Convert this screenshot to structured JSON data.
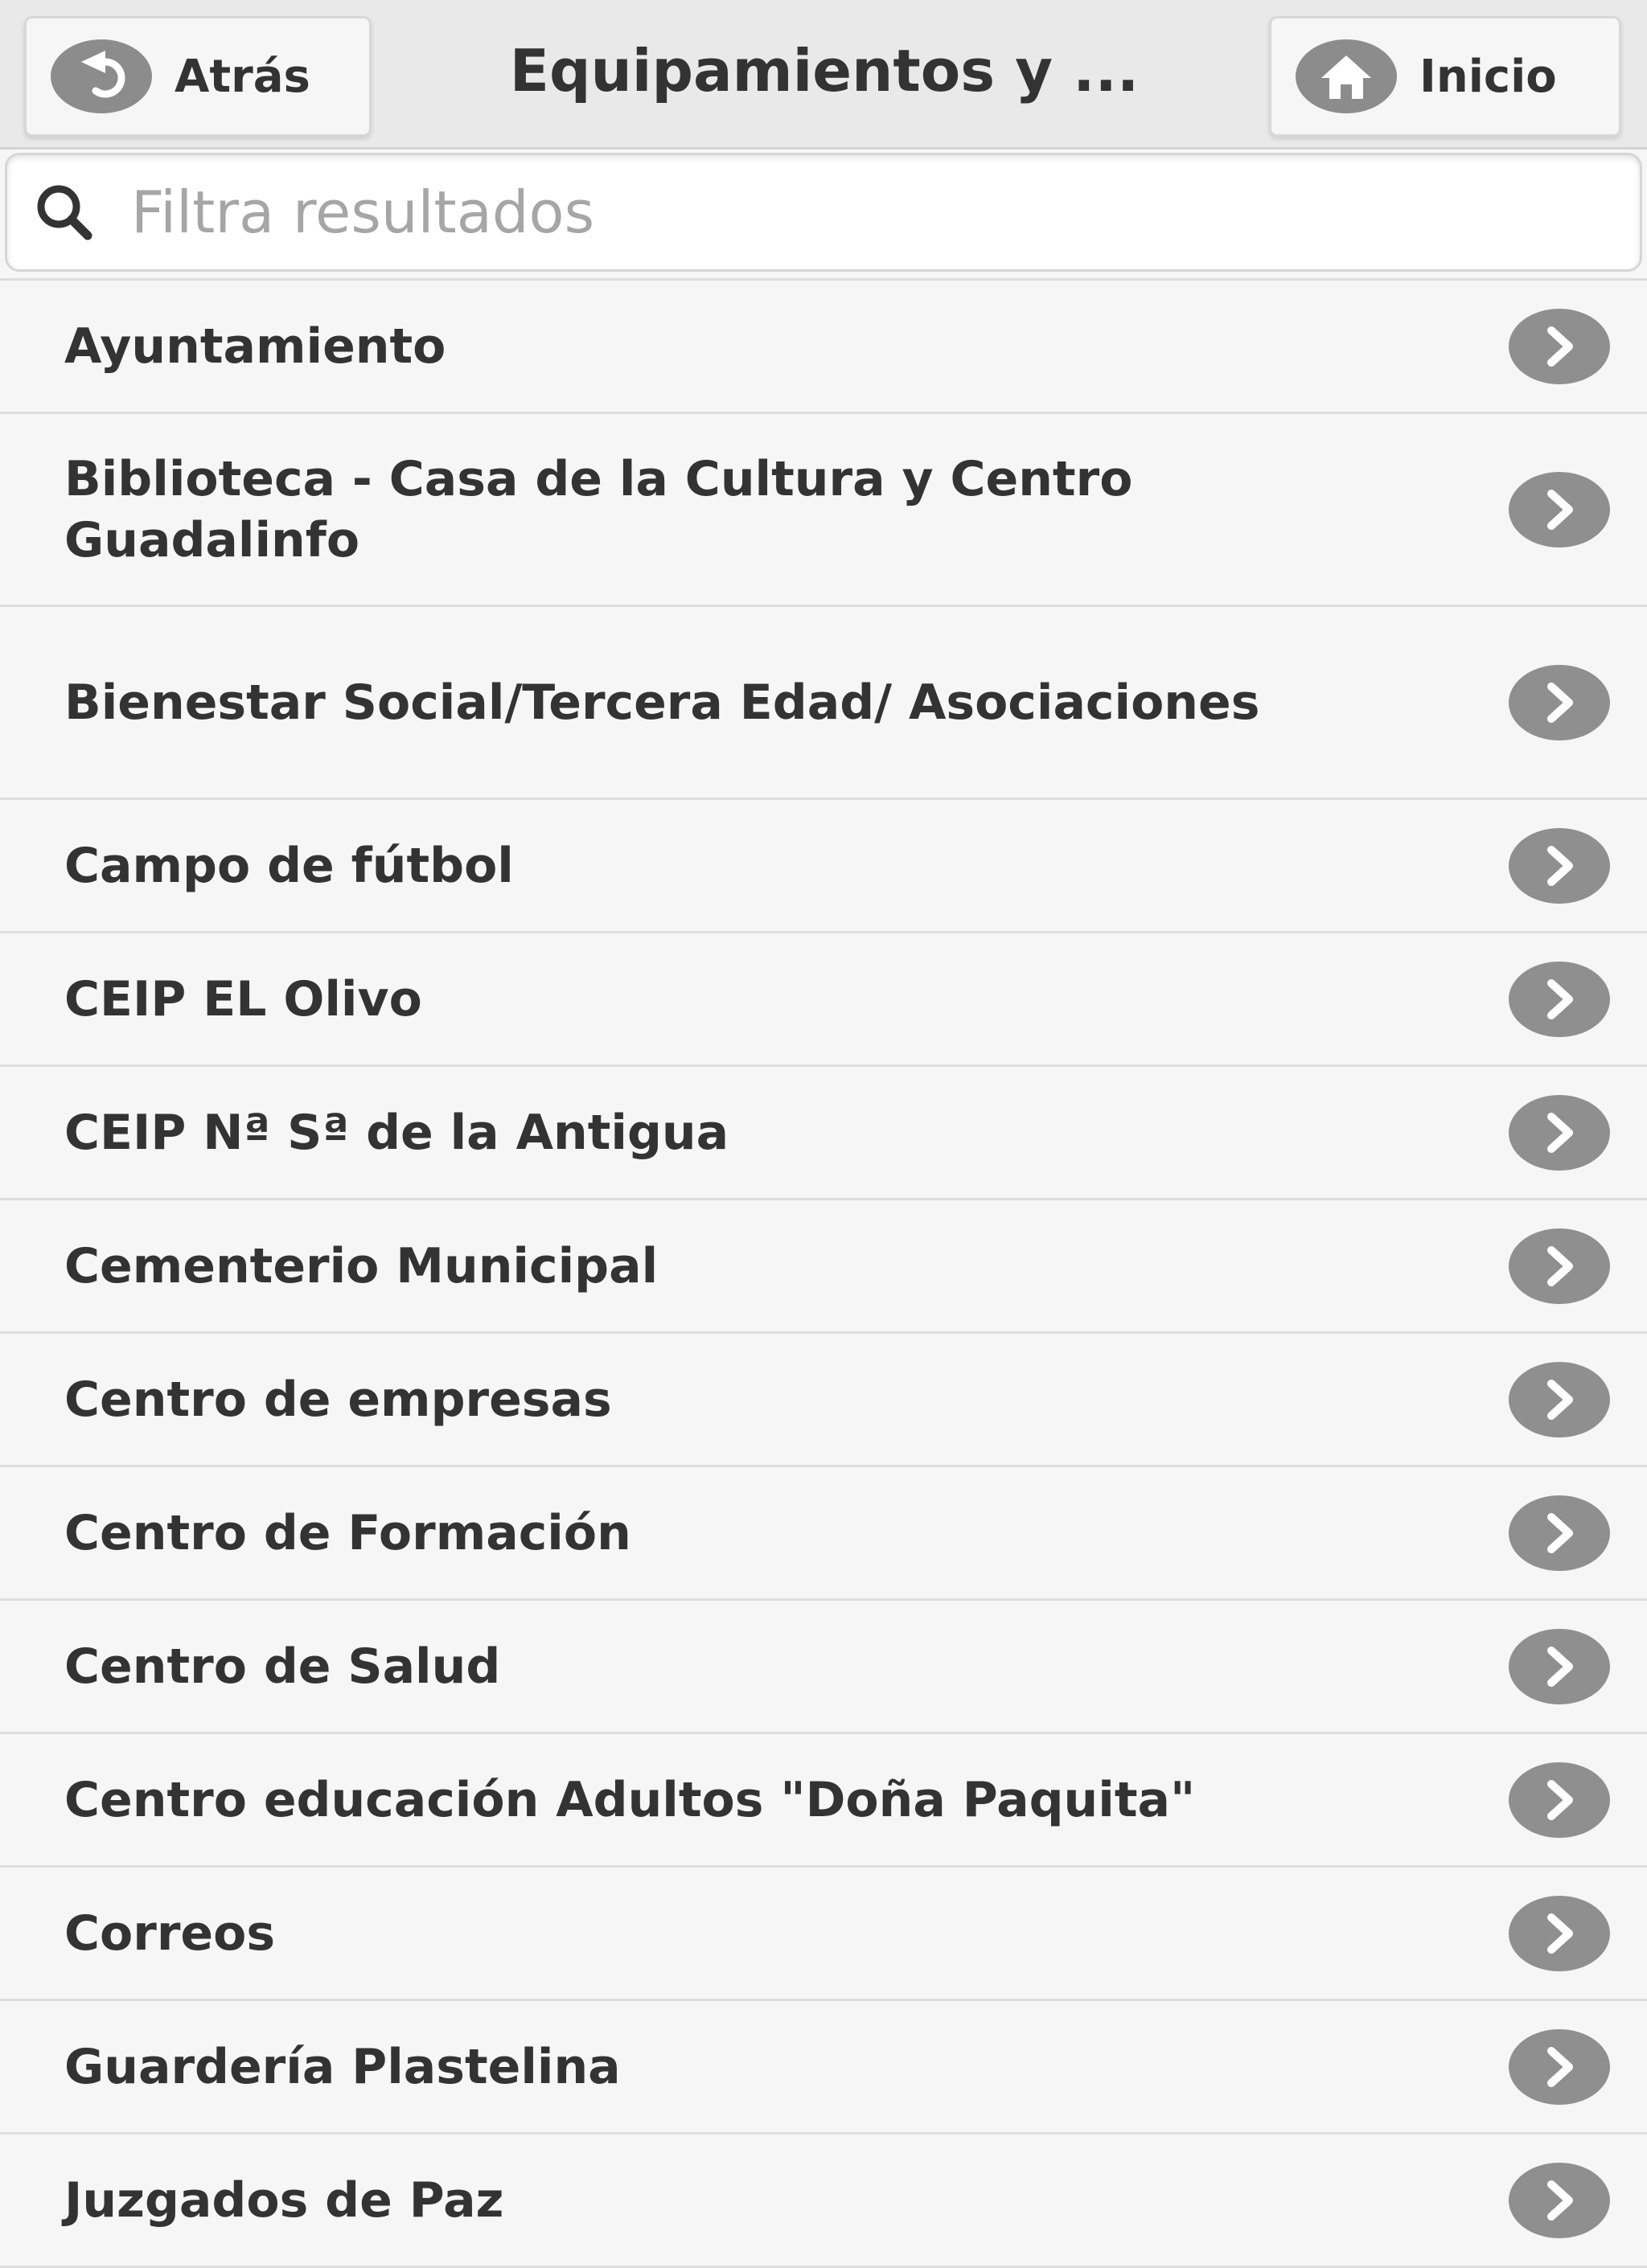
{
  "header": {
    "back_label": "Atrás",
    "title": "Equipamientos y ...",
    "home_label": "Inicio"
  },
  "search": {
    "placeholder": "Filtra resultados",
    "value": ""
  },
  "list": {
    "items": [
      "Ayuntamiento",
      "Biblioteca - Casa de la Cultura y Centro Guadalinfo",
      "Bienestar Social/Tercera Edad/ Asociaciones",
      "Campo de fútbol",
      "CEIP EL Olivo",
      "CEIP Nª Sª de la Antigua",
      "Cementerio Municipal",
      "Centro de empresas",
      "Centro de Formación",
      "Centro de Salud",
      "Centro educación Adultos \"Doña Paquita\"",
      "Correos",
      "Guardería Plastelina",
      "Juzgados de Paz"
    ]
  },
  "colors": {
    "header_bg": "#e9e9e9",
    "list_bg": "#f6f6f6",
    "icon_gray": "#8c8c8c",
    "text": "#333333"
  },
  "icons": {
    "back": "back-arrow-icon",
    "home": "home-icon",
    "search": "search-icon",
    "row": "chevron-right-icon"
  }
}
